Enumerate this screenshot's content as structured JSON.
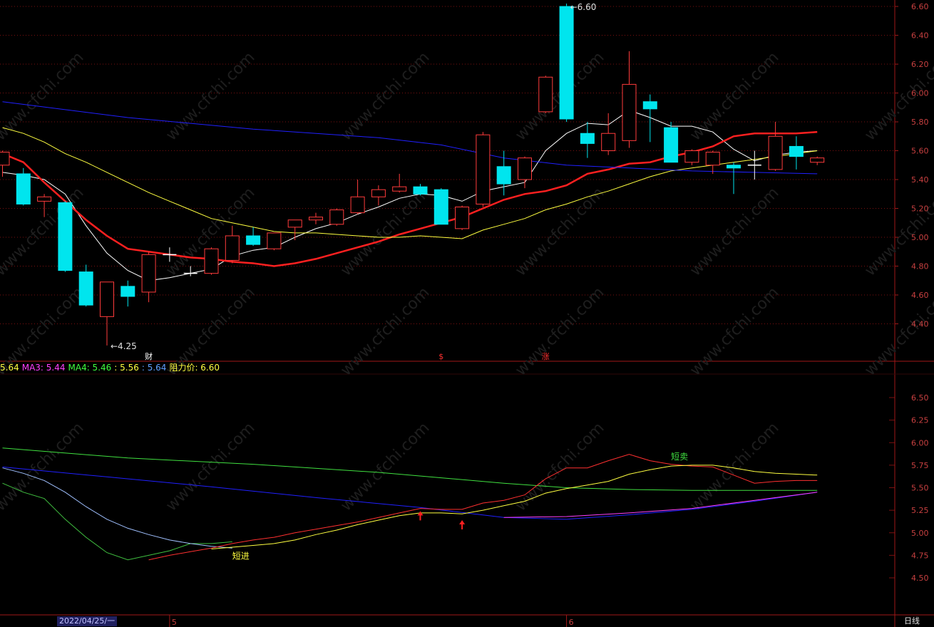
{
  "colors": {
    "up": "#ff3b3b",
    "down": "#00e5ee",
    "cross": "#ffffff",
    "grid": "#7a1010",
    "axis_text": "#c84040",
    "ma_white": "#ffffff",
    "ma_red": "#ff2020",
    "ma_yellow": "#ffff40",
    "ma_blue": "#2020ff"
  },
  "chart_data": [
    {
      "type": "candlestick",
      "panel": "main",
      "y_ticks": [
        "6.60",
        "6.40",
        "6.20",
        "6.00",
        "5.80",
        "5.60",
        "5.40",
        "5.20",
        "5.00",
        "4.80",
        "4.60",
        "4.40"
      ],
      "ylim": [
        4.2,
        6.62
      ],
      "candles": [
        {
          "o": 5.5,
          "h": 5.6,
          "l": 5.42,
          "c": 5.59
        },
        {
          "o": 5.44,
          "h": 5.48,
          "l": 5.22,
          "c": 5.23
        },
        {
          "o": 5.25,
          "h": 5.3,
          "l": 5.14,
          "c": 5.28
        },
        {
          "o": 5.24,
          "h": 5.25,
          "l": 4.76,
          "c": 4.77
        },
        {
          "o": 4.76,
          "h": 4.81,
          "l": 4.52,
          "c": 4.53
        },
        {
          "o": 4.45,
          "h": 4.69,
          "l": 4.25,
          "c": 4.69
        },
        {
          "o": 4.66,
          "h": 4.7,
          "l": 4.52,
          "c": 4.59
        },
        {
          "o": 4.62,
          "h": 4.9,
          "l": 4.55,
          "c": 4.88
        },
        {
          "o": 4.88,
          "h": 4.93,
          "l": 4.83,
          "c": 4.88
        },
        {
          "o": 4.75,
          "h": 4.8,
          "l": 4.73,
          "c": 4.75
        },
        {
          "o": 4.75,
          "h": 4.93,
          "l": 4.74,
          "c": 4.92
        },
        {
          "o": 4.84,
          "h": 5.08,
          "l": 4.82,
          "c": 5.01
        },
        {
          "o": 5.01,
          "h": 5.07,
          "l": 4.94,
          "c": 4.95
        },
        {
          "o": 4.92,
          "h": 5.03,
          "l": 4.91,
          "c": 5.03
        },
        {
          "o": 5.07,
          "h": 5.12,
          "l": 4.98,
          "c": 5.12
        },
        {
          "o": 5.12,
          "h": 5.17,
          "l": 5.09,
          "c": 5.14
        },
        {
          "o": 5.09,
          "h": 5.2,
          "l": 5.08,
          "c": 5.19
        },
        {
          "o": 5.17,
          "h": 5.4,
          "l": 5.16,
          "c": 5.28
        },
        {
          "o": 5.28,
          "h": 5.36,
          "l": 5.22,
          "c": 5.33
        },
        {
          "o": 5.32,
          "h": 5.44,
          "l": 5.31,
          "c": 5.35
        },
        {
          "o": 5.35,
          "h": 5.37,
          "l": 5.29,
          "c": 5.3
        },
        {
          "o": 5.33,
          "h": 5.34,
          "l": 5.09,
          "c": 5.09
        },
        {
          "o": 5.06,
          "h": 5.22,
          "l": 5.05,
          "c": 5.21
        },
        {
          "o": 5.23,
          "h": 5.73,
          "l": 5.21,
          "c": 5.71
        },
        {
          "o": 5.49,
          "h": 5.6,
          "l": 5.29,
          "c": 5.37
        },
        {
          "o": 5.4,
          "h": 5.56,
          "l": 5.34,
          "c": 5.55
        },
        {
          "o": 5.87,
          "h": 6.12,
          "l": 5.86,
          "c": 6.11
        },
        {
          "o": 6.6,
          "h": 6.62,
          "l": 5.8,
          "c": 5.82
        },
        {
          "o": 5.72,
          "h": 5.8,
          "l": 5.55,
          "c": 5.65
        },
        {
          "o": 5.6,
          "h": 5.86,
          "l": 5.57,
          "c": 5.72
        },
        {
          "o": 5.67,
          "h": 6.29,
          "l": 5.62,
          "c": 6.06
        },
        {
          "o": 5.94,
          "h": 5.99,
          "l": 5.66,
          "c": 5.89
        },
        {
          "o": 5.76,
          "h": 5.8,
          "l": 5.52,
          "c": 5.52
        },
        {
          "o": 5.52,
          "h": 5.61,
          "l": 5.5,
          "c": 5.6
        },
        {
          "o": 5.5,
          "h": 5.6,
          "l": 5.44,
          "c": 5.59
        },
        {
          "o": 5.5,
          "h": 5.52,
          "l": 5.3,
          "c": 5.48
        },
        {
          "o": 5.5,
          "h": 5.6,
          "l": 5.4,
          "c": 5.5
        },
        {
          "o": 5.47,
          "h": 5.8,
          "l": 5.46,
          "c": 5.7
        },
        {
          "o": 5.63,
          "h": 5.7,
          "l": 5.47,
          "c": 5.56
        },
        {
          "o": 5.52,
          "h": 5.56,
          "l": 5.5,
          "c": 5.55
        }
      ],
      "ma_lines": [
        {
          "name": "white",
          "x": [
            0,
            1,
            2,
            3,
            4,
            5,
            6,
            7,
            8,
            9,
            10,
            11,
            12,
            13,
            14,
            15,
            16,
            17,
            18,
            19,
            20,
            21,
            22,
            23,
            24,
            25,
            26,
            27,
            28,
            29,
            30,
            31,
            32,
            33,
            34,
            35,
            36,
            37,
            38,
            39
          ],
          "y": [
            5.45,
            5.43,
            5.4,
            5.3,
            5.08,
            4.89,
            4.77,
            4.7,
            4.72,
            4.75,
            4.78,
            4.87,
            4.91,
            4.93,
            5.0,
            5.06,
            5.1,
            5.16,
            5.21,
            5.27,
            5.3,
            5.29,
            5.25,
            5.32,
            5.35,
            5.38,
            5.6,
            5.72,
            5.79,
            5.78,
            5.88,
            5.83,
            5.77,
            5.77,
            5.73,
            5.61,
            5.53,
            5.57,
            5.59,
            5.6
          ]
        },
        {
          "name": "red",
          "x": [
            0,
            1,
            2,
            3,
            4,
            5,
            6,
            7,
            8,
            9,
            10,
            11,
            12,
            13,
            14,
            15,
            16,
            17,
            18,
            19,
            20,
            21,
            22,
            23,
            24,
            25,
            26,
            27,
            28,
            29,
            30,
            31,
            32,
            33,
            34,
            35,
            36,
            37,
            38,
            39
          ],
          "y": [
            5.58,
            5.52,
            5.38,
            5.25,
            5.12,
            5.01,
            4.92,
            4.9,
            4.88,
            4.86,
            4.85,
            4.83,
            4.82,
            4.8,
            4.82,
            4.85,
            4.89,
            4.93,
            4.97,
            5.02,
            5.06,
            5.1,
            5.14,
            5.2,
            5.26,
            5.3,
            5.32,
            5.36,
            5.44,
            5.47,
            5.51,
            5.52,
            5.56,
            5.59,
            5.63,
            5.7,
            5.72,
            5.72,
            5.72,
            5.73
          ]
        },
        {
          "name": "yellow",
          "x": [
            0,
            1,
            2,
            3,
            4,
            5,
            6,
            7,
            8,
            9,
            10,
            11,
            12,
            13,
            14,
            15,
            16,
            17,
            18,
            19,
            20,
            21,
            22,
            23,
            24,
            25,
            26,
            27,
            28,
            29,
            30,
            31,
            32,
            33,
            34,
            35,
            36,
            37,
            38,
            39
          ],
          "y": [
            5.76,
            5.72,
            5.66,
            5.58,
            5.52,
            5.45,
            5.38,
            5.31,
            5.25,
            5.19,
            5.13,
            5.1,
            5.07,
            5.04,
            5.03,
            5.03,
            5.02,
            5.01,
            5.0,
            5.0,
            5.01,
            5.0,
            4.99,
            5.05,
            5.09,
            5.13,
            5.19,
            5.23,
            5.28,
            5.32,
            5.37,
            5.42,
            5.46,
            5.48,
            5.5,
            5.52,
            5.54,
            5.56,
            5.58,
            5.6
          ]
        },
        {
          "name": "blue",
          "x": [
            0,
            6,
            12,
            18,
            21,
            24,
            27,
            30,
            33,
            36,
            39
          ],
          "y": [
            5.94,
            5.83,
            5.75,
            5.69,
            5.64,
            5.55,
            5.5,
            5.48,
            5.46,
            5.45,
            5.44
          ]
        }
      ],
      "annotations": [
        {
          "text": "6.60",
          "x": 27,
          "y": 6.6
        },
        {
          "text": "4.25",
          "x": 5,
          "y": 4.25
        }
      ],
      "markers": [
        {
          "text": "财",
          "x": 7,
          "color": "#ffffff"
        },
        {
          "text": "$",
          "x": 21,
          "color": "#ff3030"
        },
        {
          "text": "涨",
          "x": 26,
          "color": "#ff3030"
        }
      ]
    },
    {
      "type": "line",
      "panel": "indicator",
      "y_ticks": [
        "6.50",
        "6.25",
        "6.00",
        "5.75",
        "5.50",
        "5.25",
        "5.00",
        "4.75",
        "4.50"
      ],
      "ylim": [
        4.2,
        6.8
      ],
      "legend": [
        {
          "label": "5.64",
          "color": "#ffff40"
        },
        {
          "label": "MA3: 5.44",
          "color": "#ff40ff"
        },
        {
          "label": "MA4: 5.46",
          "color": "#40ff40"
        },
        {
          "label": ": 5.56",
          "color": "#ffff40"
        },
        {
          "label": ": 5.64",
          "color": "#60a0ff"
        },
        {
          "label": "阻力价: 6.60",
          "color": "#ffff40"
        }
      ],
      "series": [
        {
          "name": "MA4",
          "color": "#40e040",
          "x": [
            0,
            6,
            12,
            18,
            21,
            24,
            27,
            30,
            33,
            36,
            39
          ],
          "y": [
            5.94,
            5.83,
            5.76,
            5.67,
            5.61,
            5.55,
            5.5,
            5.48,
            5.47,
            5.47,
            5.47
          ]
        },
        {
          "name": "blue",
          "color": "#2020ff",
          "x": [
            0,
            5,
            10,
            15,
            20,
            24,
            27,
            30,
            33,
            36,
            39
          ],
          "y": [
            5.73,
            5.62,
            5.51,
            5.39,
            5.28,
            5.17,
            5.15,
            5.2,
            5.26,
            5.35,
            5.45
          ]
        },
        {
          "name": "MA3",
          "color": "#ff40ff",
          "x": [
            24,
            27,
            30,
            33,
            36,
            39
          ],
          "y": [
            5.17,
            5.18,
            5.22,
            5.27,
            5.36,
            5.45
          ]
        },
        {
          "name": "green2",
          "color": "#40c040",
          "x": [
            0,
            1,
            2,
            3,
            4,
            5,
            6,
            7,
            8,
            9,
            10,
            11
          ],
          "y": [
            5.55,
            5.45,
            5.38,
            5.15,
            4.95,
            4.78,
            4.7,
            4.75,
            4.8,
            4.88,
            4.88,
            4.9
          ]
        },
        {
          "name": "lightblue",
          "color": "#a0c0ff",
          "x": [
            0,
            1,
            2,
            3,
            4,
            5,
            6,
            7,
            8,
            9,
            10,
            11
          ],
          "y": [
            5.72,
            5.66,
            5.58,
            5.45,
            5.29,
            5.15,
            5.05,
            4.98,
            4.92,
            4.88,
            4.85,
            4.83
          ]
        },
        {
          "name": "red",
          "color": "#ff3030",
          "x": [
            7,
            8,
            9,
            10,
            11,
            12,
            13,
            14,
            15,
            16,
            17,
            18,
            19,
            20,
            21,
            22,
            23,
            24,
            25,
            26,
            27,
            28,
            29,
            30,
            31,
            32,
            33,
            34,
            35,
            36,
            37,
            38,
            39
          ],
          "y": [
            4.7,
            4.75,
            4.79,
            4.83,
            4.88,
            4.92,
            4.95,
            5.0,
            5.04,
            5.08,
            5.12,
            5.17,
            5.22,
            5.27,
            5.26,
            5.26,
            5.33,
            5.36,
            5.42,
            5.6,
            5.72,
            5.72,
            5.8,
            5.87,
            5.8,
            5.76,
            5.74,
            5.73,
            5.64,
            5.55,
            5.57,
            5.58,
            5.58
          ]
        },
        {
          "name": "yellow",
          "color": "#ffff40",
          "x": [
            10,
            11,
            12,
            13,
            14,
            15,
            16,
            17,
            18,
            19,
            20,
            21,
            22,
            23,
            24,
            25,
            26,
            27,
            28,
            29,
            30,
            31,
            32,
            33,
            34,
            35,
            36,
            37,
            38,
            39
          ],
          "y": [
            4.82,
            4.84,
            4.86,
            4.88,
            4.92,
            4.98,
            5.03,
            5.09,
            5.14,
            5.19,
            5.22,
            5.22,
            5.21,
            5.25,
            5.3,
            5.35,
            5.44,
            5.49,
            5.53,
            5.57,
            5.65,
            5.7,
            5.74,
            5.75,
            5.75,
            5.72,
            5.68,
            5.66,
            5.65,
            5.64
          ]
        }
      ],
      "signals": [
        {
          "text": "短进",
          "x": 11,
          "y": 4.75,
          "color": "#ffff40"
        },
        {
          "text": "短卖",
          "x": 32,
          "y": 5.85,
          "color": "#40e040"
        }
      ],
      "arrows": [
        {
          "x": 20,
          "y": 5.24
        },
        {
          "x": 22,
          "y": 5.14
        }
      ]
    }
  ],
  "x_axis": {
    "date_label": "2022/04/25/一",
    "ticks": [
      {
        "label": "5",
        "x": 8
      },
      {
        "label": "6",
        "x": 27
      }
    ],
    "period_label": "日线"
  },
  "watermark": "www.cfchi.com"
}
